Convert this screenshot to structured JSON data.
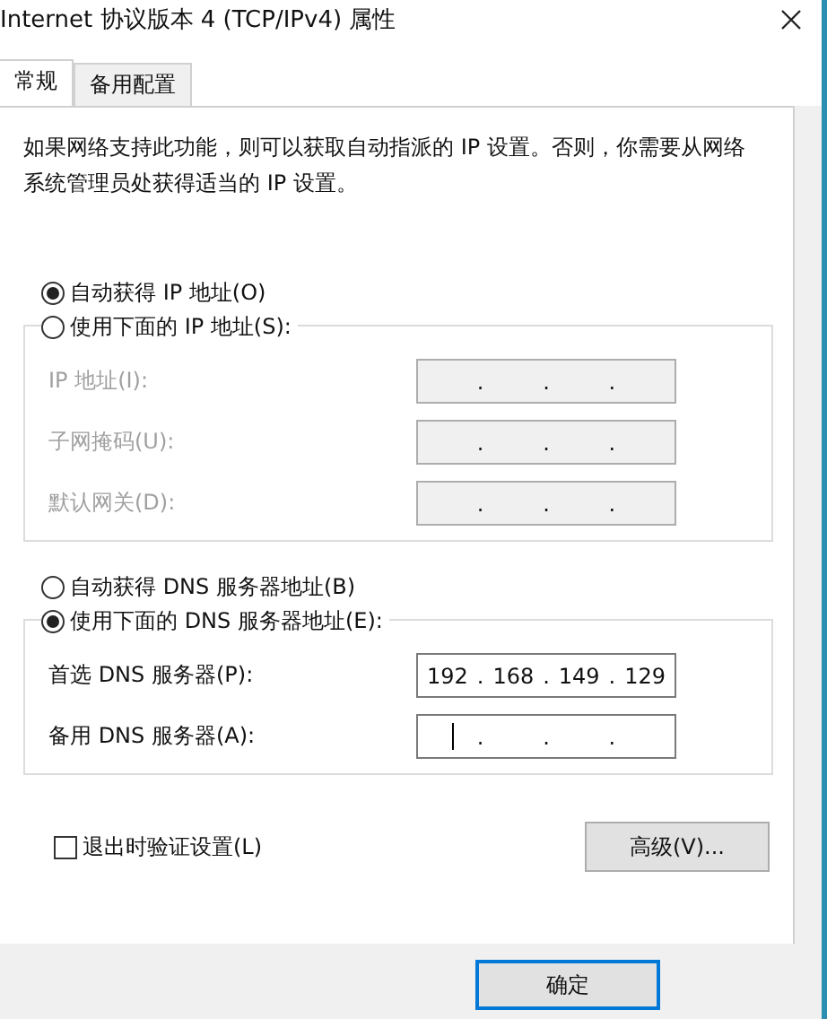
{
  "window": {
    "title": "Internet 协议版本 4 (TCP/IPv4) 属性"
  },
  "tabs": [
    {
      "label": "常规",
      "selected": true
    },
    {
      "label": "备用配置",
      "selected": false
    }
  ],
  "description": "如果网络支持此功能，则可以获取自动指派的 IP 设置。否则，你需要从网络系统管理员处获得适当的 IP 设置。",
  "ip_options": [
    {
      "label": "自动获得 IP 地址(O)",
      "selected": true
    },
    {
      "label": "使用下面的 IP 地址(S):",
      "selected": false
    }
  ],
  "ip_fields": [
    {
      "label": "IP 地址(I):",
      "disabled": true,
      "focused": false,
      "segments": [
        ".",
        ".",
        "."
      ]
    },
    {
      "label": "子网掩码(U):",
      "disabled": true,
      "focused": false,
      "segments": [
        ".",
        ".",
        "."
      ]
    },
    {
      "label": "默认网关(D):",
      "disabled": true,
      "focused": false,
      "segments": [
        ".",
        ".",
        "."
      ]
    }
  ],
  "dns_options": [
    {
      "label": "自动获得 DNS 服务器地址(B)",
      "selected": false
    },
    {
      "label": "使用下面的 DNS 服务器地址(E):",
      "selected": true
    }
  ],
  "dns_fields": [
    {
      "label": "首选 DNS 服务器(P):",
      "disabled": false,
      "focused": false,
      "segments": [
        "192",
        ".",
        "168",
        ".",
        "149",
        ".",
        "129"
      ]
    },
    {
      "label": "备用 DNS 服务器(A):",
      "disabled": false,
      "focused": true,
      "segments": [
        ".",
        ".",
        "."
      ]
    }
  ],
  "validate": {
    "label": "退出时验证设置(L)",
    "checked": false
  },
  "advanced_button": {
    "label": "高级(V)...",
    "default": false
  },
  "ok_button": {
    "label": "确定",
    "default": true
  }
}
